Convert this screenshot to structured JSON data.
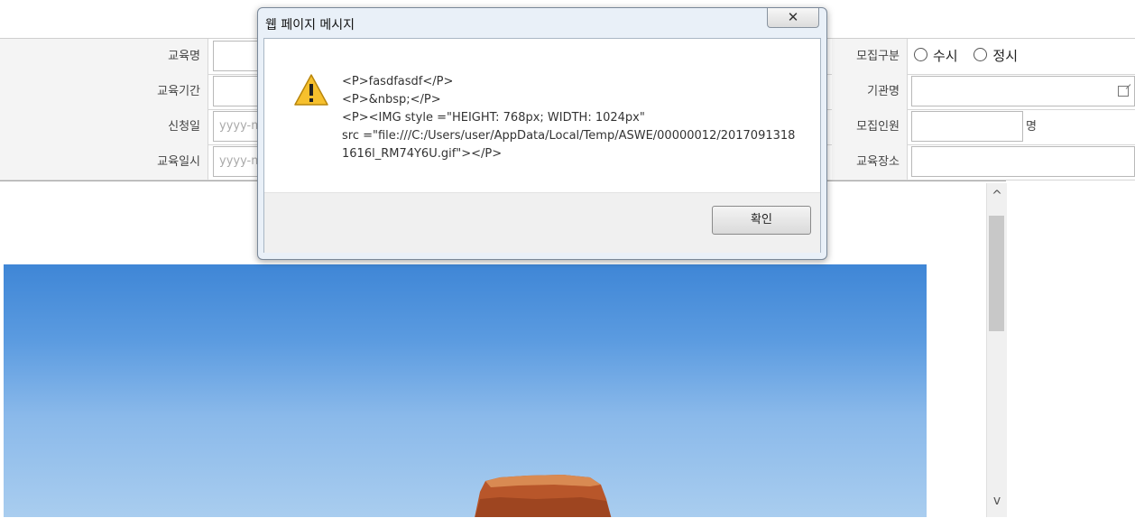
{
  "form": {
    "rows": [
      {
        "left_label": "교육명",
        "left_value": "",
        "right_label": "모집구분",
        "radio_options": [
          "수시",
          "정시"
        ]
      },
      {
        "left_label": "교육기간",
        "left_value": "",
        "right_label": "기관명",
        "right_value": ""
      },
      {
        "left_label": "신청일",
        "left_placeholder": "yyyy-m",
        "right_label": "모집인원",
        "right_value": "",
        "unit": "명"
      },
      {
        "left_label": "교육일시",
        "left_placeholder": "yyyy-m",
        "right_label": "교육장소",
        "right_value": ""
      }
    ]
  },
  "dialog": {
    "title": "웹 페이지 메시지",
    "message_lines": [
      "<P>fasdfasdf</P>",
      "<P>&nbsp;</P>",
      "<P><IMG style =\"HEIGHT: 768px; WIDTH: 1024px\"",
      "src =\"file:///C:/Users/user/AppData/Local/Temp/ASWE/00000012/20170913181616l_RM74Y6U.gif\"></P>"
    ],
    "ok_label": "확인",
    "close_glyph": "✕",
    "icon": "warning-icon"
  },
  "scrollbar": {
    "up_glyph": "^",
    "down_glyph": "v"
  },
  "colors": {
    "sky": "#4a8fdb",
    "dialog_bg": "#e9f0f8",
    "label_bg": "#f4f4f4"
  }
}
